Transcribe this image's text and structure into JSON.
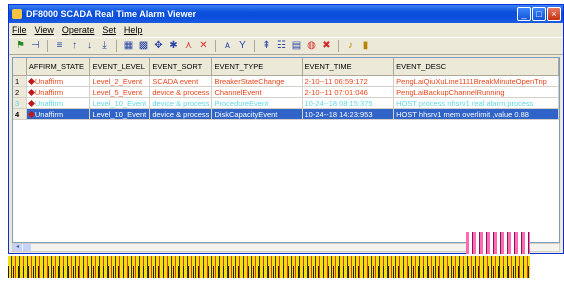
{
  "window": {
    "title": "DF8000 SCADA Real Time Alarm Viewer",
    "controls": [
      "minimize",
      "maximize",
      "close"
    ]
  },
  "menu": [
    "File",
    "View",
    "Operate",
    "Set",
    "Help"
  ],
  "toolbar_icons": [
    "pin-icon",
    "filter-icon",
    "sort-icon",
    "up-arrow-icon",
    "down-arrow-icon",
    "bottom-arrow-icon",
    "grid-icon",
    "grid-select-icon",
    "confirm-all-icon",
    "confirm-icon",
    "delete-icon",
    "find-icon",
    "filter-funnel-icon",
    "print-icon",
    "columns-icon",
    "save-icon",
    "clear-icon",
    "sound-icon",
    "exit-icon"
  ],
  "columns": [
    "",
    "AFFIRM_STATE",
    "EVENT_LEVEL",
    "EVENT_SORT",
    "EVENT_TYPE",
    "EVENT_TIME",
    "EVENT_DESC"
  ],
  "rows": [
    {
      "num": "1",
      "state": "Unaffirm",
      "level": "Level_2_Event",
      "sort": "SCADA event",
      "type": "BreakerStateChange",
      "time": "2-10--11 06:59:172",
      "desc": "PengLaiQiuXuLine1111BreakMinuteOpenTrip"
    },
    {
      "num": "2",
      "state": "Unaffirm",
      "level": "Level_5_Event",
      "sort": "device & process",
      "type": "ChannelEvent",
      "time": "2-10--11 07:01:046",
      "desc": "PengLaiBackupChannelRunning"
    },
    {
      "num": "3",
      "state": "Unaffirm",
      "level": "Level_10_Event",
      "sort": "device & process",
      "type": "ProcedureEvent",
      "time": "10-24--18 08:15:375",
      "desc": "HOST process nhsrv1 real alarm process"
    },
    {
      "num": "4",
      "state": "Unaffirm",
      "level": "Level_10_Event",
      "sort": "device & process",
      "type": "DiskCapacityEvent",
      "time": "10-24--18 14:23:953",
      "desc": "HOST hhsrv1 mem overlimit ,value 0.88"
    }
  ],
  "colors": {
    "title_bar": "#0a4fdc",
    "selected_row": "#3064c8",
    "alarm_text": "#e8451c",
    "info_text": "#5fd6e8"
  }
}
